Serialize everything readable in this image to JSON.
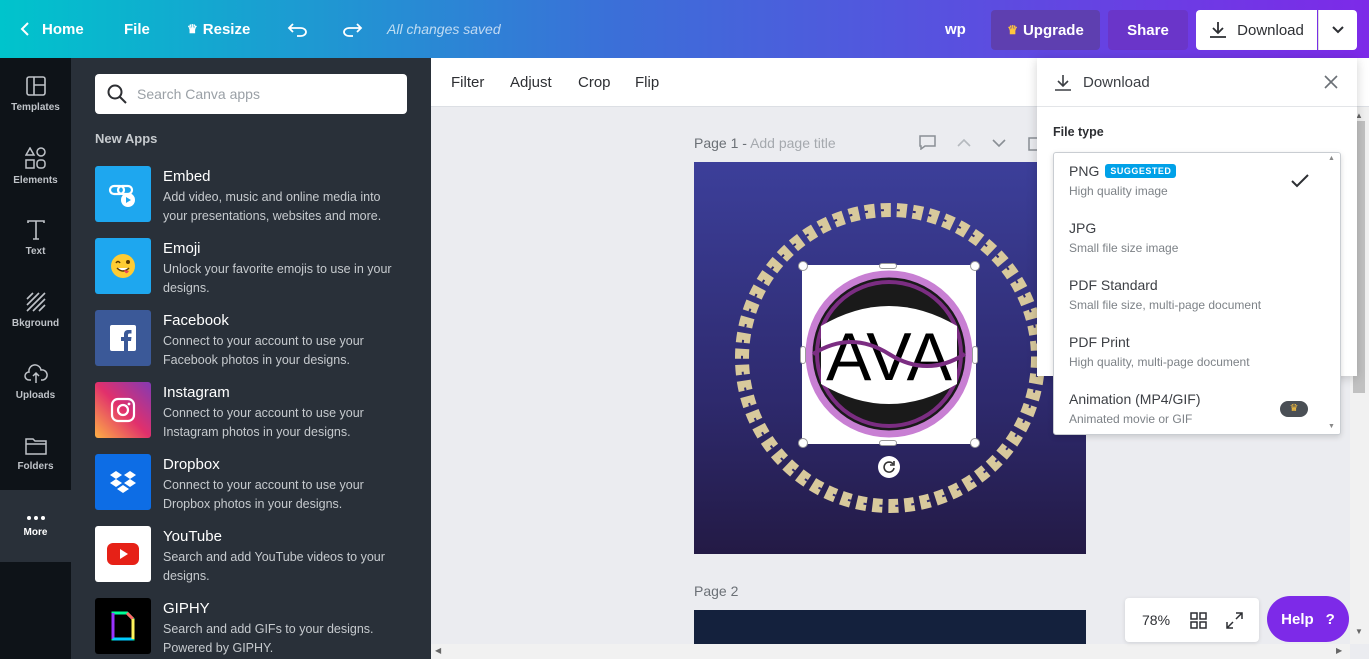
{
  "topbar": {
    "home_label": "Home",
    "file_label": "File",
    "resize_label": "Resize",
    "saved_status": "All changes saved",
    "user_label": "wp",
    "upgrade_label": "Upgrade",
    "share_label": "Share",
    "download_label": "Download"
  },
  "sidebar": {
    "items": [
      {
        "label": "Templates",
        "icon": "templates-icon"
      },
      {
        "label": "Elements",
        "icon": "elements-icon"
      },
      {
        "label": "Text",
        "icon": "text-icon"
      },
      {
        "label": "Bkground",
        "icon": "background-icon"
      },
      {
        "label": "Uploads",
        "icon": "uploads-icon"
      },
      {
        "label": "Folders",
        "icon": "folders-icon"
      },
      {
        "label": "More",
        "icon": "more-icon"
      }
    ]
  },
  "panel": {
    "search_placeholder": "Search Canva apps",
    "section_title": "New Apps",
    "apps": [
      {
        "name": "Embed",
        "desc": "Add video, music and online media into your presentations, websites and more.",
        "color": "#1ea7ef"
      },
      {
        "name": "Emoji",
        "desc": "Unlock your favorite emojis to use in your designs.",
        "color": "#1ea7ef"
      },
      {
        "name": "Facebook",
        "desc": "Connect to your account to use your Facebook photos in your designs.",
        "color": "#3b5998"
      },
      {
        "name": "Instagram",
        "desc": "Connect to your account to use your Instagram photos in your designs.",
        "color": "#c13584"
      },
      {
        "name": "Dropbox",
        "desc": "Connect to your account to use your Dropbox photos in your designs.",
        "color": "#0d6de5"
      },
      {
        "name": "YouTube",
        "desc": "Search and add YouTube videos to your designs.",
        "color": "#ffffff"
      },
      {
        "name": "GIPHY",
        "desc": "Search and add GIFs to your designs. Powered by GIPHY.",
        "color": "#000000"
      }
    ]
  },
  "toolbar": {
    "filter_label": "Filter",
    "adjust_label": "Adjust",
    "crop_label": "Crop",
    "flip_label": "Flip"
  },
  "canvas": {
    "page1_label": "Page 1 -",
    "page1_title_placeholder": "Add page title",
    "page2_label": "Page 2",
    "logo_text": "AVA"
  },
  "download_panel": {
    "title": "Download",
    "file_type_label": "File type",
    "options": [
      {
        "name": "PNG",
        "desc": "High quality image",
        "badge": "SUGGESTED",
        "selected": true
      },
      {
        "name": "JPG",
        "desc": "Small file size image"
      },
      {
        "name": "PDF Standard",
        "desc": "Small file size, multi-page document"
      },
      {
        "name": "PDF Print",
        "desc": "High quality, multi-page document"
      },
      {
        "name": "Animation (MP4/GIF)",
        "desc": "Animated movie or GIF",
        "premium": true
      }
    ]
  },
  "footer": {
    "zoom": "78%",
    "help_label": "Help",
    "help_icon": "?"
  },
  "colors": {
    "accent": "#7d2ae8",
    "teal": "#00c4cc",
    "sidebar_bg": "#0e1318",
    "panel_bg": "#293039"
  }
}
